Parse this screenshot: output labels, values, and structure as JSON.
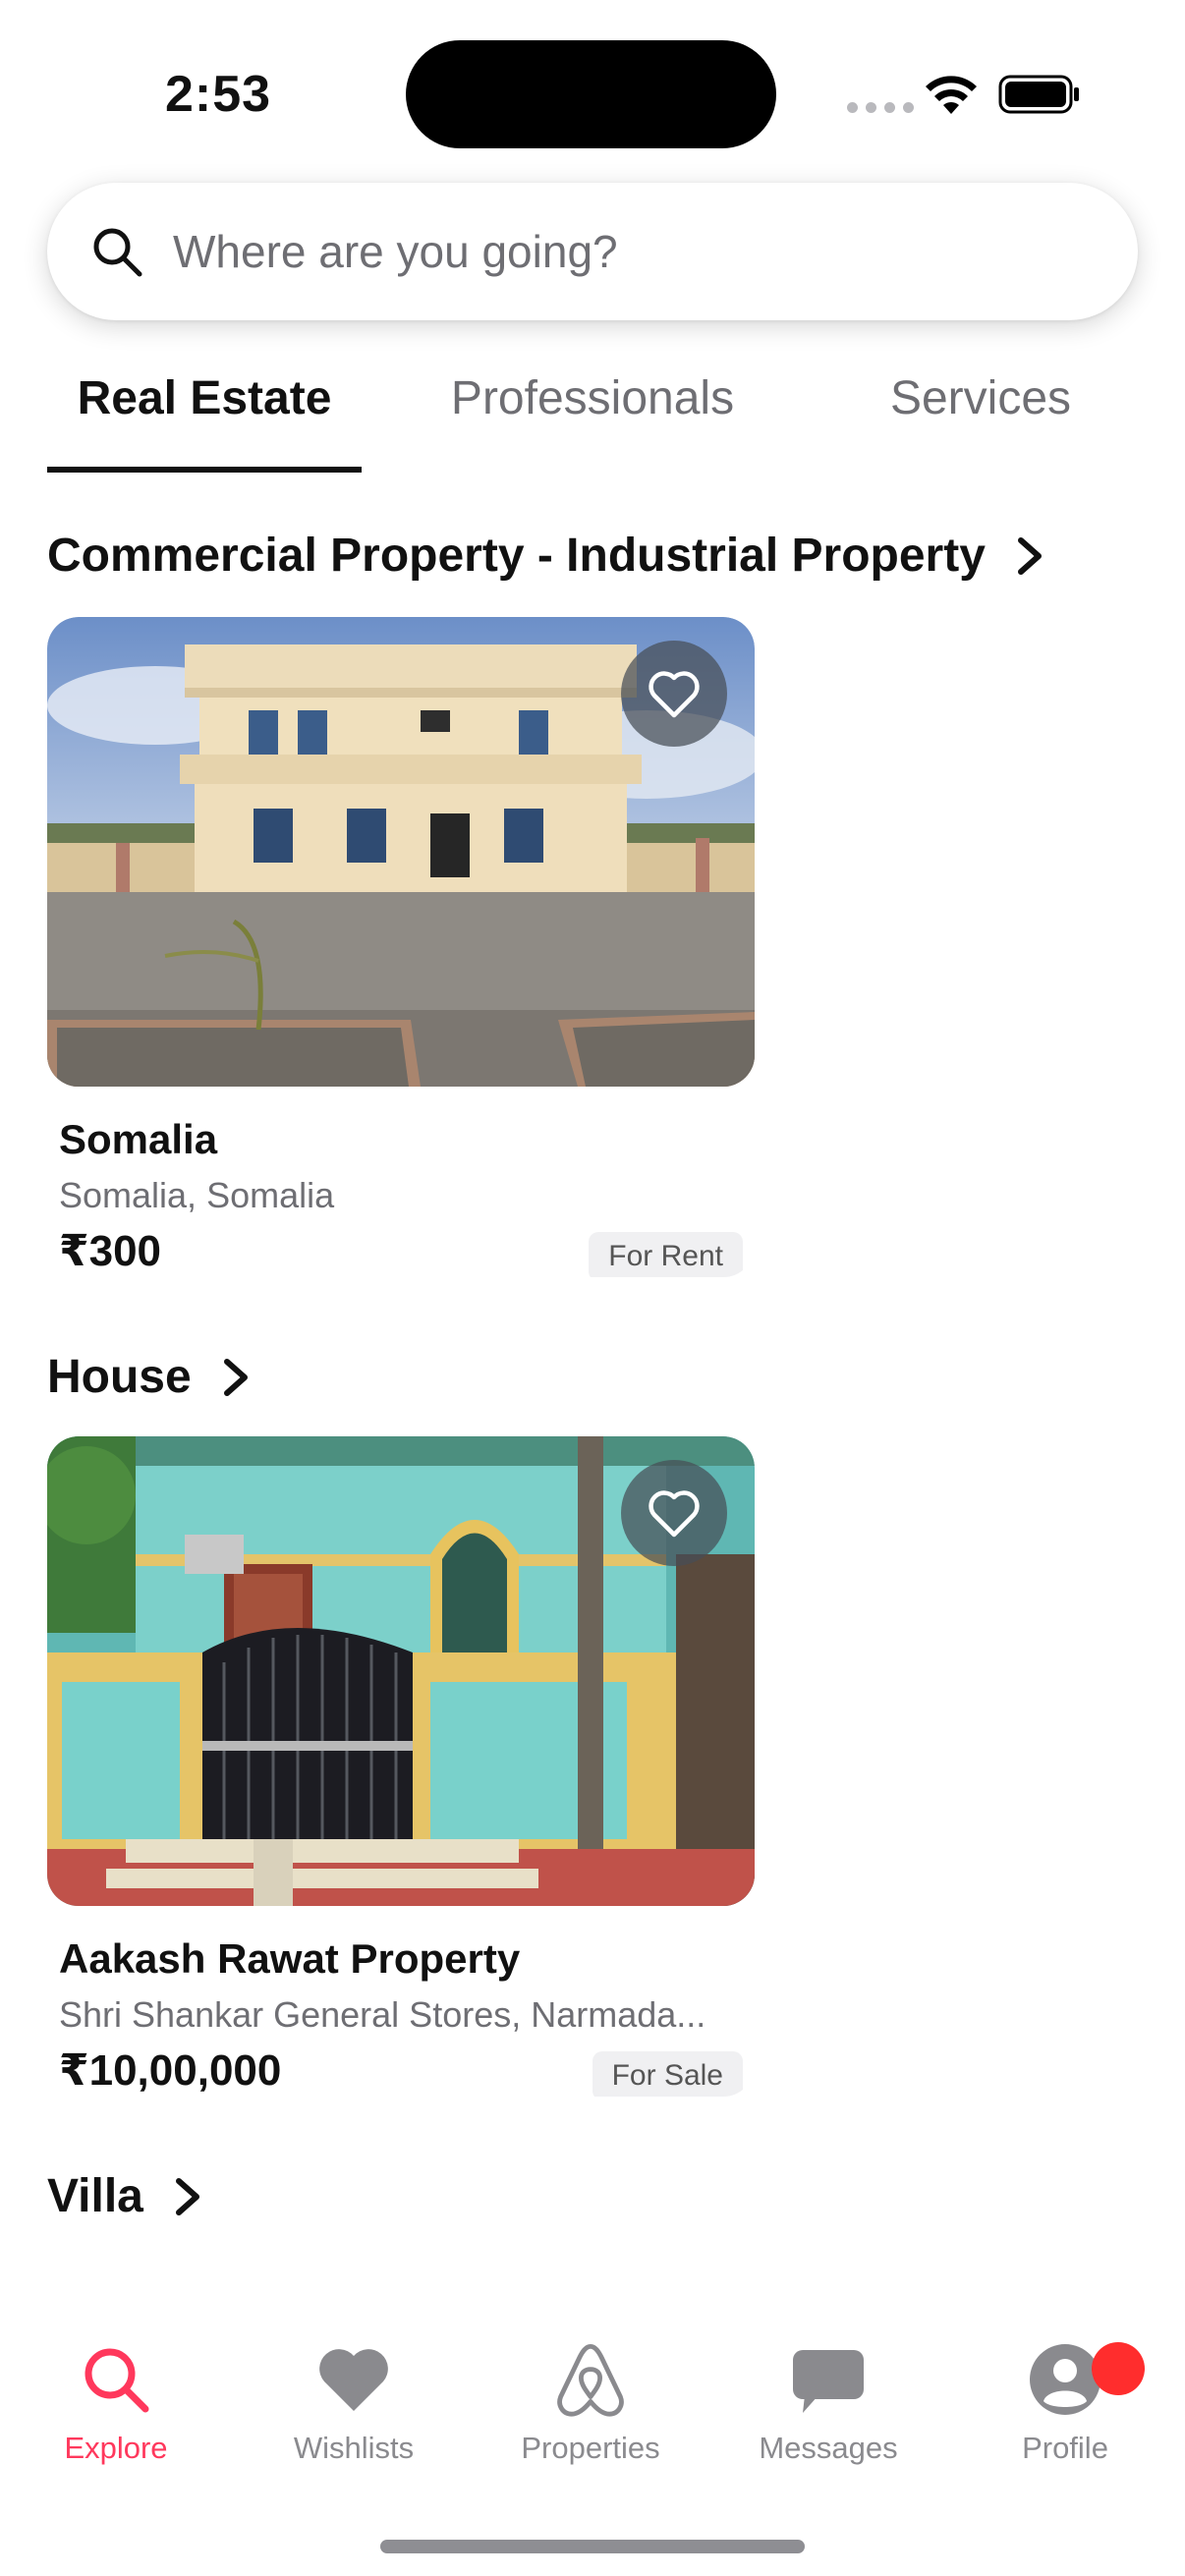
{
  "status": {
    "time": "2:53"
  },
  "search": {
    "placeholder": "Where are you going?"
  },
  "tabs": [
    {
      "label": "Real Estate",
      "active": true
    },
    {
      "label": "Professionals",
      "active": false
    },
    {
      "label": "Services",
      "active": false
    }
  ],
  "sections": [
    {
      "title": "Commercial Property - Industrial Property",
      "card": {
        "title": "Somalia",
        "location": "Somalia, Somalia",
        "price": "₹300",
        "badge": "For Rent",
        "image_icon": "building-photo"
      }
    },
    {
      "title": "House",
      "card": {
        "title": "Aakash Rawat Property",
        "location": "Shri Shankar General Stores, Narmada...",
        "price": "₹10,00,000",
        "badge": "For Sale",
        "image_icon": "house-photo"
      }
    },
    {
      "title": "Villa"
    }
  ],
  "tabbar": {
    "items": [
      {
        "label": "Explore",
        "icon": "search-icon",
        "active": true
      },
      {
        "label": "Wishlists",
        "icon": "heart-icon",
        "active": false
      },
      {
        "label": "Properties",
        "icon": "airbnb-logo-icon",
        "active": false
      },
      {
        "label": "Messages",
        "icon": "chat-bubble-icon",
        "active": false
      },
      {
        "label": "Profile",
        "icon": "person-icon",
        "active": false
      }
    ]
  },
  "colors": {
    "accent": "#ff385c",
    "inactive": "#8a8a8e",
    "notification": "#ff2d2d"
  }
}
